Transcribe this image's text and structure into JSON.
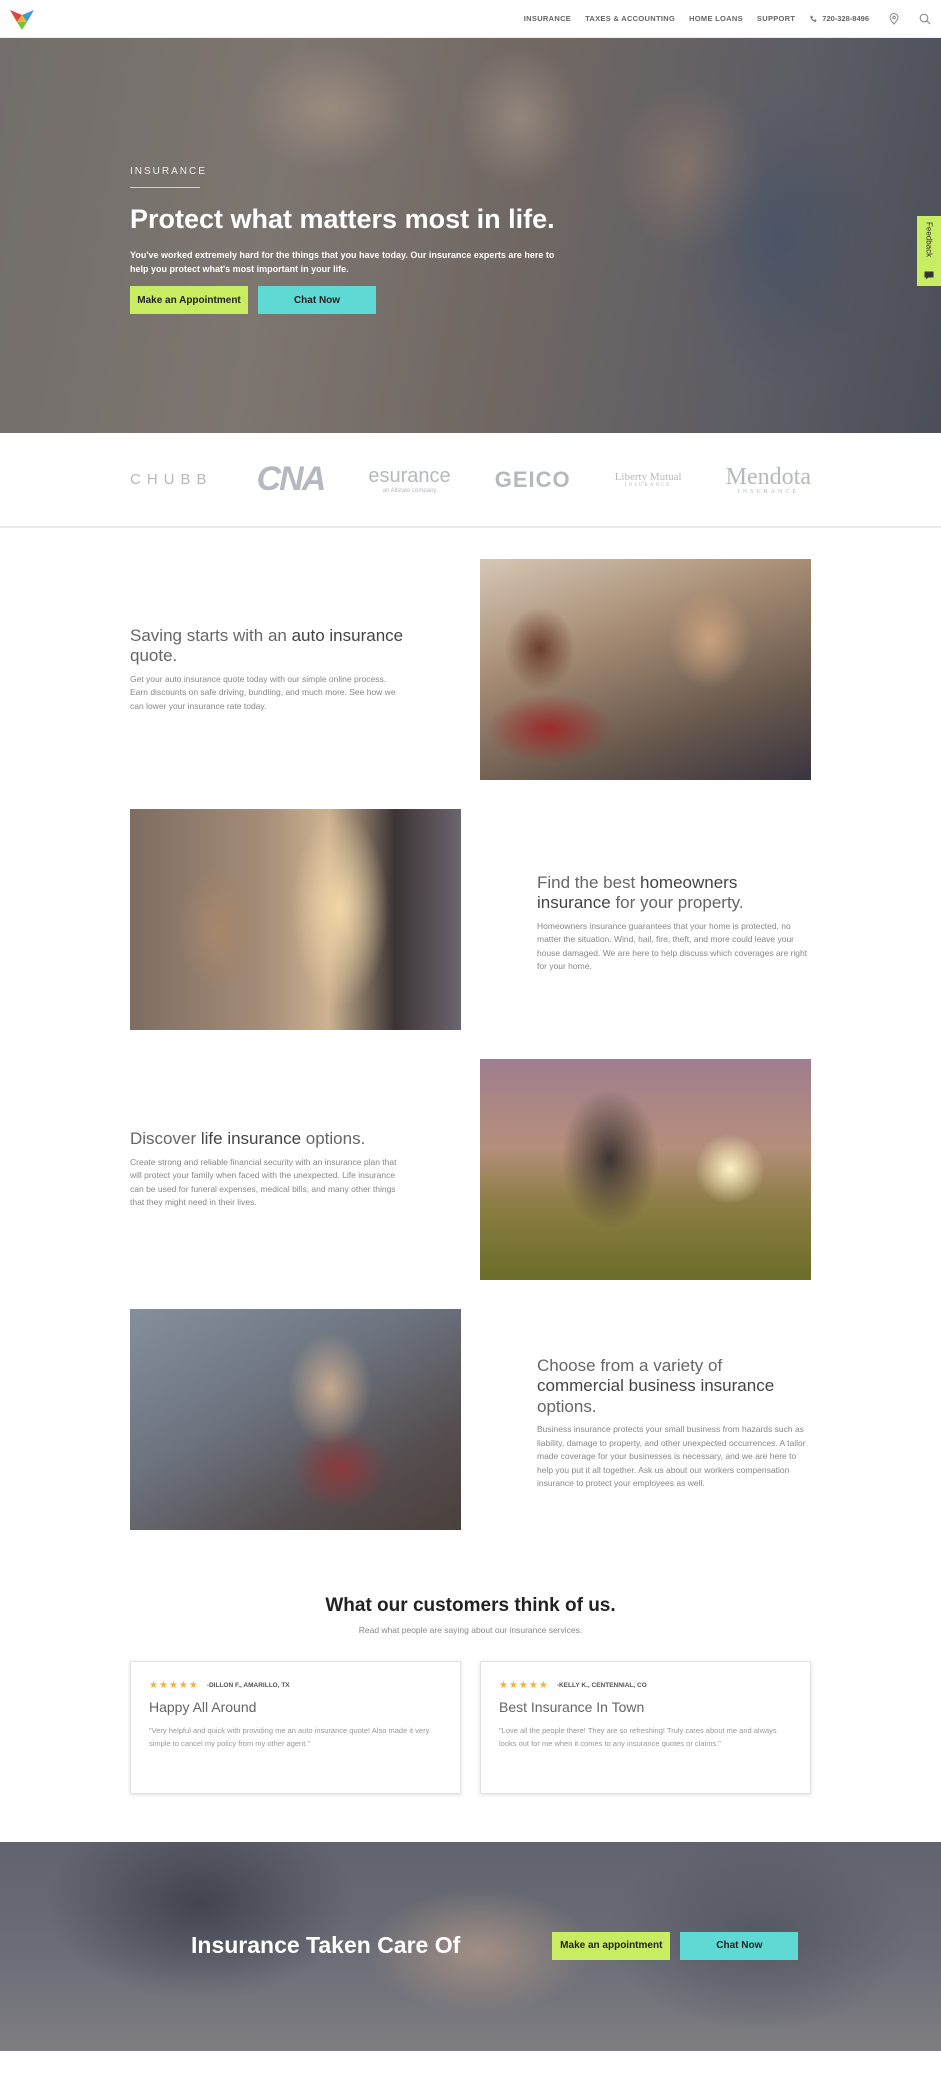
{
  "header": {
    "nav": [
      "INSURANCE",
      "TAXES & ACCOUNTING",
      "HOME LOANS",
      "SUPPORT"
    ],
    "phone": "720-328-8496"
  },
  "hero": {
    "eyebrow": "INSURANCE",
    "title": "Protect what matters most in life.",
    "text": "You've worked extremely hard for the things that you have today. Our insurance experts are here to help you protect what's most important in your life.",
    "btn_appointment": "Make an Appointment",
    "btn_chat": "Chat Now",
    "feedback": "Feedback"
  },
  "logos": {
    "chubb": "CHUBB",
    "cna": "CNA",
    "esurance": "esurance",
    "esurance_sub": "an Allstate company",
    "geico": "GEICO",
    "liberty": "Liberty Mutual",
    "liberty_sub": "INSURANCE",
    "mendota": "Mendota",
    "mendota_sub": "INSURANCE"
  },
  "features": [
    {
      "pre": "Saving starts with an ",
      "strong": "auto insurance",
      "post": " quote.",
      "text": "Get your auto insurance quote today with our simple online process. Earn discounts on safe driving, bundling, and much more. See how we can lower your insurance rate today."
    },
    {
      "pre": "Find the best ",
      "strong": "homeowners insurance",
      "post": " for your property.",
      "text": "Homeowners insurance guarantees that your home is protected, no matter the situation. Wind, hail, fire, theft, and more could leave your house damaged. We are here to help discuss which coverages are right for your home."
    },
    {
      "pre": "Discover ",
      "strong": "life insurance",
      "post": " options.",
      "text": "Create strong and reliable financial security with an insurance plan that will protect your family when faced with the unexpected. Life insurance can be used for funeral expenses, medical bills, and many other things that they might need in their lives."
    },
    {
      "pre": "Choose from a variety of ",
      "strong": "commercial business insurance",
      "post": " options.",
      "text": "Business insurance protects your small business from hazards such as liability, damage to property, and other unexpected occurrences. A tailor made coverage for your businesses is necessary, and we are here to help you put it all together. Ask us about our workers compensation insurance to protect your employees as well."
    }
  ],
  "testimonials": {
    "title": "What our customers think of us.",
    "subtitle": "Read what people are saying about our insurance services.",
    "cards": [
      {
        "stars": "★★★★★",
        "author": "-DILLON F., AMARILLO, TX",
        "title": "Happy All Around",
        "quote": "\"Very helpful and quick with providing me an auto insurance quote! Also made it very simple to cancel my policy from my other agent.\""
      },
      {
        "stars": "★★★★★",
        "author": "-KELLY K., CENTENNIAL, CO",
        "title": "Best Insurance In Town",
        "quote": "\"Love all the people there! They are so refreshing! Truly cares about me and always looks out for me when it comes to any insurance quotes or claims.\""
      }
    ]
  },
  "cta": {
    "title": "Insurance Taken Care Of",
    "btn_appointment": "Make an appointment",
    "btn_chat": "Chat Now"
  }
}
